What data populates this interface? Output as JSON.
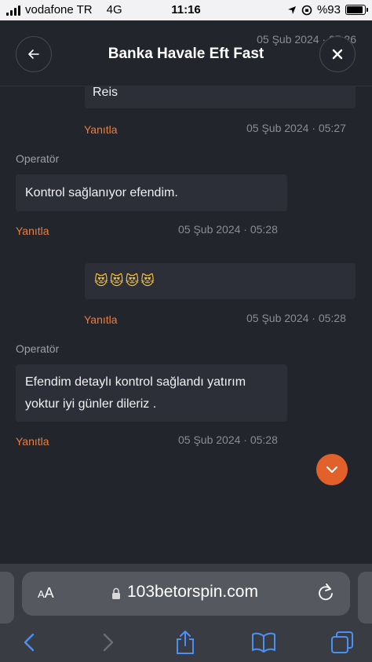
{
  "status_bar": {
    "carrier": "vodafone TR",
    "network": "4G",
    "time": "11:16",
    "battery": "%93",
    "battery_level": 0.93
  },
  "header": {
    "title": "Banka Havale Eft Fast",
    "timestamp": "05 Şub 2024 · 05:26",
    "back_icon": "chevron-left-icon",
    "close_icon": "close-icon"
  },
  "messages": [
    {
      "text": "Reis",
      "reply_label": "Yanıtla",
      "timestamp": "05 Şub 2024 · 05:27"
    },
    {
      "sender": "Operatör",
      "text": "Kontrol sağlanıyor efendim.",
      "reply_label": "Yanıtla",
      "timestamp": "05 Şub 2024 · 05:28"
    },
    {
      "text": "😻😻😻😻",
      "reply_label": "Yanıtla",
      "timestamp": "05 Şub 2024 · 05:28"
    },
    {
      "sender": "Operatör",
      "text_line1": "Efendim detaylı kontrol sağlandı yatırım",
      "text_line2": "yoktur iyi günler dileriz .",
      "reply_label": "Yanıtla",
      "timestamp": "05 Şub 2024 · 05:28"
    }
  ],
  "safari": {
    "aa_label_small": "A",
    "aa_label_big": "A",
    "url": "103betorspin.com",
    "colors": {
      "accent": "#4a90f5",
      "reply": "#ef7d3c",
      "scroll_button": "#e2612a"
    }
  }
}
